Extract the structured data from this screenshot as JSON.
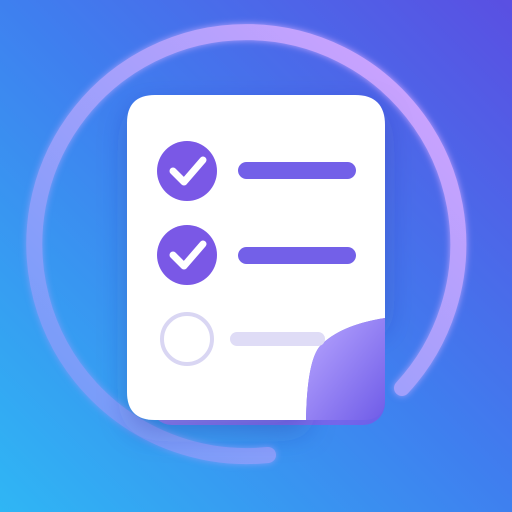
{
  "icon": {
    "name": "checklist-app-icon",
    "items": [
      {
        "checked": true
      },
      {
        "checked": true
      },
      {
        "checked": false
      }
    ]
  },
  "colors": {
    "background_light": "#2fb6f4",
    "background_mid": "#3f7eef",
    "background_dark": "#5a4fe2",
    "ring_start": "#6a9cf8",
    "ring_end": "#d7a3ff",
    "note_paper": "#ffffff",
    "check_accent": "#7a58e6",
    "line_accent": "#7360e8",
    "unchecked_outline": "#d9d6f3",
    "unchecked_line": "#dfdcf6",
    "page_curl_front": "#b9a7ff",
    "page_curl_back": "#6f5ce8"
  }
}
